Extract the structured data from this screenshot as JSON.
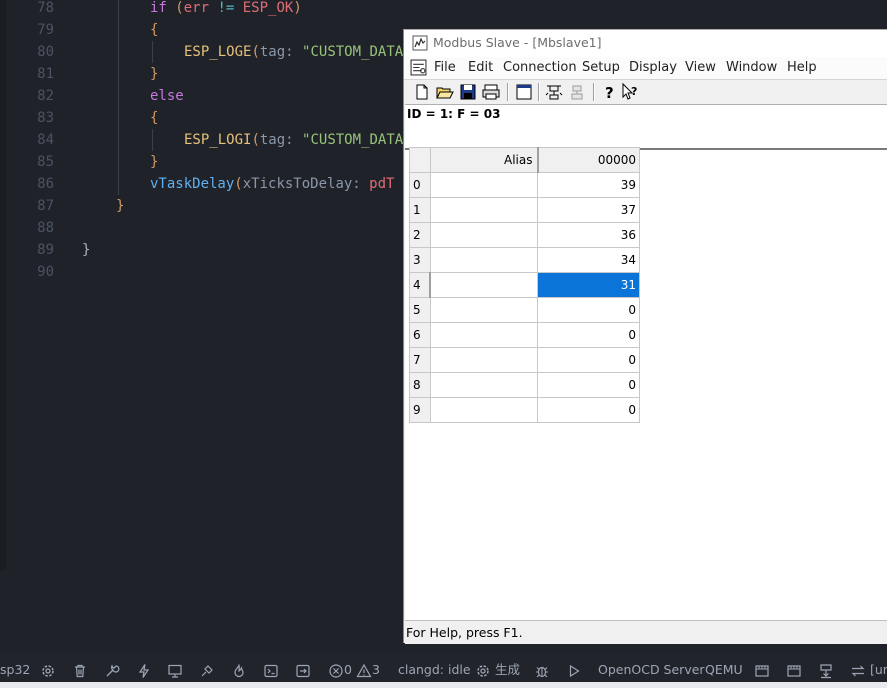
{
  "editor": {
    "lines": [
      {
        "num": "78",
        "indent": 2,
        "tokens": [
          [
            "kw",
            "if "
          ],
          [
            "br",
            "("
          ],
          [
            "plain",
            "err "
          ],
          [
            "op",
            "!= "
          ],
          [
            "plain",
            "ESP_OK"
          ],
          [
            "br",
            ")"
          ]
        ]
      },
      {
        "num": "79",
        "indent": 2,
        "tokens": [
          [
            "br",
            "{"
          ]
        ]
      },
      {
        "num": "80",
        "indent": 3,
        "tokens": [
          [
            "fn",
            "ESP_LOGE"
          ],
          [
            "br",
            "("
          ],
          [
            "param",
            "tag: "
          ],
          [
            "str",
            "\"CUSTOM_DATA"
          ]
        ]
      },
      {
        "num": "81",
        "indent": 2,
        "tokens": [
          [
            "br",
            "}"
          ]
        ]
      },
      {
        "num": "82",
        "indent": 2,
        "tokens": [
          [
            "kw",
            "else"
          ]
        ]
      },
      {
        "num": "83",
        "indent": 2,
        "tokens": [
          [
            "br",
            "{"
          ]
        ]
      },
      {
        "num": "84",
        "indent": 3,
        "tokens": [
          [
            "fn",
            "ESP_LOGI"
          ],
          [
            "br",
            "("
          ],
          [
            "param",
            "tag: "
          ],
          [
            "str",
            "\"CUSTOM_DATA"
          ]
        ]
      },
      {
        "num": "85",
        "indent": 2,
        "tokens": [
          [
            "br",
            "}"
          ]
        ]
      },
      {
        "num": "86",
        "indent": 2,
        "tokens": [
          [
            "fn2",
            "vTaskDelay"
          ],
          [
            "br",
            "("
          ],
          [
            "param",
            "xTicksToDelay: "
          ],
          [
            "plain",
            "pdT"
          ]
        ]
      },
      {
        "num": "87",
        "indent": 1,
        "tokens": [
          [
            "br",
            "}"
          ]
        ]
      },
      {
        "num": "88",
        "indent": 0,
        "tokens": []
      },
      {
        "num": "89",
        "indent": 0,
        "tokens": [
          [
            "plain0",
            "}"
          ]
        ]
      },
      {
        "num": "90",
        "indent": 0,
        "tokens": []
      }
    ]
  },
  "statusbar": {
    "target": "sp32",
    "errors": "0",
    "warnings": "3",
    "clangd": "clangd: idle",
    "build_label": "生成",
    "openocd": "OpenOCD Server",
    "qemu": "QEMU",
    "tail": "[un"
  },
  "modbus": {
    "title": "Modbus Slave - [Mbslave1]",
    "menu": [
      "File",
      "Edit",
      "Connection",
      "Setup",
      "Display",
      "View",
      "Window",
      "Help"
    ],
    "info": "ID = 1: F = 03",
    "grid": {
      "alias_header": "Alias",
      "value_header": "00000",
      "rows": [
        {
          "index": "0",
          "alias": "",
          "value": "39"
        },
        {
          "index": "1",
          "alias": "",
          "value": "37"
        },
        {
          "index": "2",
          "alias": "",
          "value": "36"
        },
        {
          "index": "3",
          "alias": "",
          "value": "34"
        },
        {
          "index": "4",
          "alias": "",
          "value": "31"
        },
        {
          "index": "5",
          "alias": "",
          "value": "0"
        },
        {
          "index": "6",
          "alias": "",
          "value": "0"
        },
        {
          "index": "7",
          "alias": "",
          "value": "0"
        },
        {
          "index": "8",
          "alias": "",
          "value": "0"
        },
        {
          "index": "9",
          "alias": "",
          "value": "0"
        }
      ],
      "selected_row": 4
    },
    "status": "For Help, press F1."
  },
  "icons": {
    "toolbar": [
      "new-icon",
      "open-icon",
      "save-icon",
      "print-icon",
      "window-icon",
      "connect-icon",
      "disconnect-icon",
      "help-icon",
      "context-help-icon"
    ],
    "statusbar": [
      "gear-icon",
      "trash-icon",
      "wrench-icon",
      "flash-icon",
      "monitor-icon",
      "device-icon",
      "flame-icon",
      "terminal-icon",
      "exit-icon",
      "error-icon",
      "warning-icon",
      "settings-icon",
      "bug-icon",
      "play-icon",
      "download-icon",
      "sync-icon"
    ]
  },
  "colors": {
    "selection": "#0a74d9",
    "editor_bg": "#1f2329"
  }
}
